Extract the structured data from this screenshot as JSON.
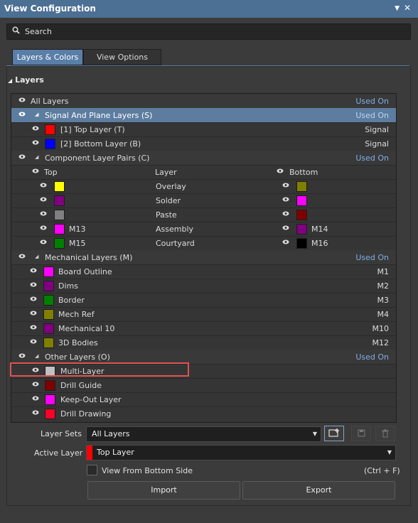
{
  "panel": {
    "title": "View Configuration",
    "pin_icon": "▼",
    "close_icon": "✕"
  },
  "search": {
    "placeholder": "Search"
  },
  "tabs": [
    {
      "label": "Layers & Colors",
      "active": true
    },
    {
      "label": "View Options",
      "active": false
    }
  ],
  "section": {
    "title": "Layers"
  },
  "tree": {
    "all_layers": {
      "label": "All Layers",
      "status": "Used On"
    },
    "signal_group": {
      "label": "Signal And Plane Layers (S)",
      "status": "Used On"
    },
    "signal_layers": [
      {
        "label": "[1] Top Layer (T)",
        "color": "#ff0000",
        "type": "Signal"
      },
      {
        "label": "[2] Bottom Layer (B)",
        "color": "#0000ff",
        "type": "Signal"
      }
    ],
    "component_group": {
      "label": "Component Layer Pairs (C)",
      "status": "Used On"
    },
    "component_header": {
      "top": "Top",
      "layer": "Layer",
      "bottom": "Bottom"
    },
    "component_pairs": [
      {
        "top_color": "#ffff00",
        "top_label": "",
        "layer": "Overlay",
        "bottom_color": "#808000",
        "bottom_label": ""
      },
      {
        "top_color": "#800080",
        "top_label": "",
        "layer": "Solder",
        "bottom_color": "#ff00ff",
        "bottom_label": ""
      },
      {
        "top_color": "#808080",
        "top_label": "",
        "layer": "Paste",
        "bottom_color": "#800000",
        "bottom_label": ""
      },
      {
        "top_color": "#ff00ff",
        "top_label": "M13",
        "layer": "Assembly",
        "bottom_color": "#800080",
        "bottom_label": "M14"
      },
      {
        "top_color": "#008000",
        "top_label": "M15",
        "layer": "Courtyard",
        "bottom_color": "#000000",
        "bottom_label": "M16"
      }
    ],
    "mechanical_group": {
      "label": "Mechanical Layers (M)",
      "status": "Used On"
    },
    "mechanical_layers": [
      {
        "label": "Board Outline",
        "color": "#ff00ff",
        "code": "M1"
      },
      {
        "label": "Dims",
        "color": "#800080",
        "code": "M2"
      },
      {
        "label": "Border",
        "color": "#008000",
        "code": "M3"
      },
      {
        "label": "Mech Ref",
        "color": "#808000",
        "code": "M4"
      },
      {
        "label": "Mechanical 10",
        "color": "#800080",
        "code": "M10"
      },
      {
        "label": "3D Bodies",
        "color": "#808000",
        "code": "M12"
      }
    ],
    "other_group": {
      "label": "Other Layers (O)",
      "status": "Used On"
    },
    "other_layers": [
      {
        "label": "Multi-Layer",
        "color": "#c0c0c0"
      },
      {
        "label": "Drill Guide",
        "color": "#800000"
      },
      {
        "label": "Keep-Out Layer",
        "color": "#ff00ff"
      },
      {
        "label": "Drill Drawing",
        "color": "#ff002a"
      }
    ]
  },
  "layer_sets": {
    "label": "Layer Sets",
    "value": "All Layers"
  },
  "active_layer": {
    "label": "Active Layer",
    "value": "Top Layer",
    "color": "#ff0000"
  },
  "view_from_bottom": {
    "label": "View From Bottom Side",
    "shortcut": "(Ctrl + F)",
    "checked": false
  },
  "buttons": {
    "import": "Import",
    "export": "Export"
  }
}
